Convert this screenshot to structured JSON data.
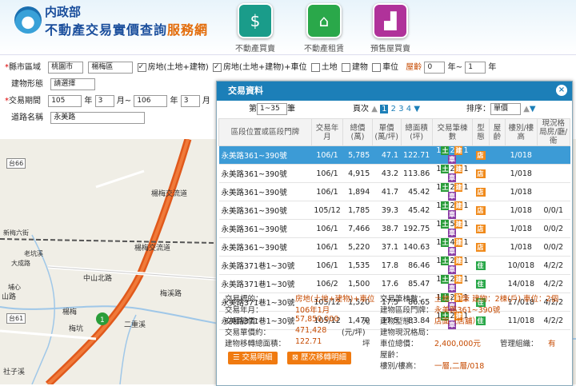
{
  "header": {
    "agency": "内政部",
    "site_title": "不動產交易實價查詢",
    "site_title_accent": "服務網",
    "nav": [
      {
        "label": "不動產買賣",
        "icon": "house-dollar-icon",
        "color": "#1a9c8a"
      },
      {
        "label": "不動產租賃",
        "icon": "house-rent-icon",
        "color": "#2aa84a"
      },
      {
        "label": "預售屋買賣",
        "icon": "crane-building-icon",
        "color": "#b0329a"
      }
    ]
  },
  "form": {
    "city_label": "縣市區域",
    "city_value": "桃園市",
    "district_value": "楊梅區",
    "types": [
      {
        "label": "房地(土地+建物)",
        "checked": true
      },
      {
        "label": "房地(土地+建物)+車位",
        "checked": true
      },
      {
        "label": "土地",
        "checked": false
      },
      {
        "label": "建物",
        "checked": false
      },
      {
        "label": "車位",
        "checked": false
      }
    ],
    "age_label": "屋齡",
    "age_from": "0",
    "age_sep": "年~",
    "age_to": "1",
    "age_unit": "年",
    "building_label": "建物形態",
    "building_value": "請選擇",
    "period_label": "交易期間",
    "year_from": "105",
    "year_lbl": "年",
    "month_from": "3",
    "month_lbl": "月~",
    "year_to": "106",
    "year_lbl2": "年",
    "month_to": "3",
    "month_lbl2": "月",
    "road_label": "道路名稱",
    "road_value": "永美路"
  },
  "map": {
    "labels": [
      "楊梅交流道",
      "楊梅交流道",
      "中山北路",
      "楊梅",
      "梅溪路",
      "二重溪",
      "台66",
      "台61",
      "新梅六街",
      "老坑溪",
      "大成路",
      "梅坑",
      "社子溪",
      "山路",
      "埔心"
    ]
  },
  "panel": {
    "title": "交易資料",
    "close": "×",
    "page_label": "第",
    "page_value": "1~35",
    "page_unit": "筆",
    "pages_label": "頁次",
    "pages": [
      "1",
      "2",
      "3",
      "4"
    ],
    "sort_label": "排序：",
    "sort_value": "單價",
    "columns": [
      "區段位置或區段門牌",
      "交易年月",
      "總價(萬)",
      "單價(萬/坪)",
      "總面積(坪)",
      "交易筆棟數",
      "型態",
      "屋齡",
      "樓別/樓高",
      "現況格局房/廳/衛"
    ],
    "rows": [
      {
        "addr": "永美路361~390號",
        "ym": "106/1",
        "total": "5,785",
        "unit": "47.1",
        "area": "122.71",
        "b": [
          "1",
          "2",
          "1"
        ],
        "type": "店",
        "floor": "1/018",
        "layout": ""
      },
      {
        "addr": "永美路361~390號",
        "ym": "106/1",
        "total": "4,915",
        "unit": "43.2",
        "area": "113.86",
        "b": [
          "1",
          "2",
          "1"
        ],
        "type": "店",
        "floor": "1/018",
        "layout": ""
      },
      {
        "addr": "永美路361~390號",
        "ym": "106/1",
        "total": "1,894",
        "unit": "41.7",
        "area": "45.42",
        "b": [
          "1",
          "2",
          "1"
        ],
        "type": "店",
        "floor": "1/018",
        "layout": ""
      },
      {
        "addr": "永美路361~390號",
        "ym": "105/12",
        "total": "1,785",
        "unit": "39.3",
        "area": "45.42",
        "b": [
          "1",
          "2",
          "1"
        ],
        "type": "店",
        "floor": "1/018",
        "layout": "0/0/1"
      },
      {
        "addr": "永美路361~390號",
        "ym": "106/1",
        "total": "7,466",
        "unit": "38.7",
        "area": "192.75",
        "b": [
          "1",
          "5",
          "1"
        ],
        "type": "店",
        "floor": "1/018",
        "layout": "0/0/2"
      },
      {
        "addr": "永美路361~390號",
        "ym": "106/1",
        "total": "5,220",
        "unit": "37.1",
        "area": "140.63",
        "b": [
          "1",
          "4",
          "1"
        ],
        "type": "店",
        "floor": "1/018",
        "layout": "0/0/2"
      },
      {
        "addr": "永美路371巷1~30號",
        "ym": "106/1",
        "total": "1,535",
        "unit": "17.8",
        "area": "86.46",
        "b": [
          "1",
          "2",
          "1"
        ],
        "type": "住",
        "floor": "10/018",
        "layout": "4/2/2"
      },
      {
        "addr": "永美路371巷1~30號",
        "ym": "106/2",
        "total": "1,500",
        "unit": "17.6",
        "area": "85.47",
        "b": [
          "1",
          "2",
          "1"
        ],
        "type": "住",
        "floor": "14/018",
        "layout": "4/2/2"
      },
      {
        "addr": "永美路371巷1~30號",
        "ym": "105/12",
        "total": "1,520",
        "unit": "17.5",
        "area": "86.65",
        "b": [
          "1",
          "2",
          "1"
        ],
        "type": "住",
        "floor": "17/018",
        "layout": "4/2/2"
      },
      {
        "addr": "永美路371巷1~30號",
        "ym": "105/12",
        "total": "1,470",
        "unit": "17.5",
        "area": "83.84",
        "b": [
          "1",
          "2",
          "1"
        ],
        "type": "住",
        "floor": "11/018",
        "layout": "4/2/2"
      }
    ],
    "detail": {
      "l1": "交易標的：",
      "v1": "房地(土地+建物)+車位",
      "l2": "交易筆棟數：",
      "v2": "土地：1筆 建物：2棟(戶) 車位：2個",
      "l3": "交易年月：",
      "v3": "106年1月",
      "l4": "建物區段門牌：",
      "v4": "永美路361~390號",
      "l5": "交易總價：",
      "v5": "57,850,000",
      "u5": "元",
      "l6": "建物型態：",
      "v6": "店面（店舖）",
      "l7": "交易單價約：",
      "v7": "471,428",
      "u7": "(元/坪)",
      "l8": "建物現況格局：",
      "v8": "",
      "l9": "建物移轉總面積：",
      "v9": "122.71",
      "u9": "坪",
      "l10": "車位總價：",
      "v10": "2,400,000元",
      "l11": "管理組織：",
      "v11": "有",
      "l12": "屋齡：",
      "v12": "",
      "l13": "樓別/樓高：",
      "v13": "一層,二層/018",
      "btn1": "交易明細",
      "btn2": "歷次移轉明細"
    }
  }
}
